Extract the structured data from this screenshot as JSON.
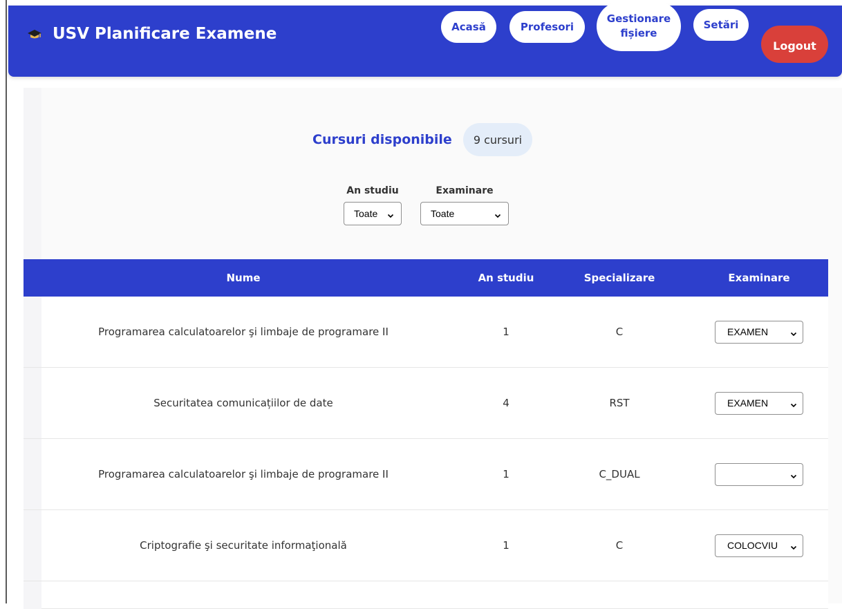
{
  "brand": {
    "title": "USV Planificare Examene",
    "icon": "graduation-cap-icon"
  },
  "nav": {
    "items": [
      {
        "label": "Acasă"
      },
      {
        "label": "Profesori"
      },
      {
        "label": "Gestionare fișiere"
      },
      {
        "label": "Setări"
      }
    ],
    "logout_label": "Logout"
  },
  "colors": {
    "primary": "#2d3fcc",
    "danger": "#d9403a",
    "pill_bg": "#e4edf9"
  },
  "courses": {
    "heading": "Cursuri disponibile",
    "count_label": "9 cursuri"
  },
  "filters": {
    "year_label": "An studiu",
    "year_value": "Toate",
    "exam_label": "Examinare",
    "exam_value": "Toate"
  },
  "table": {
    "headers": [
      "Nume",
      "An studiu",
      "Specializare",
      "Examinare"
    ],
    "rows": [
      {
        "name": "Programarea calculatoarelor şi limbaje de programare II",
        "year": "1",
        "spec": "C",
        "exam": "EXAMEN"
      },
      {
        "name": "Securitatea comunicațiilor de date",
        "year": "4",
        "spec": "RST",
        "exam": "EXAMEN"
      },
      {
        "name": "Programarea calculatoarelor şi limbaje de programare II",
        "year": "1",
        "spec": "C_DUAL",
        "exam": ""
      },
      {
        "name": "Criptografie şi securitate informaţională",
        "year": "1",
        "spec": "C",
        "exam": "COLOCVIU"
      }
    ]
  }
}
